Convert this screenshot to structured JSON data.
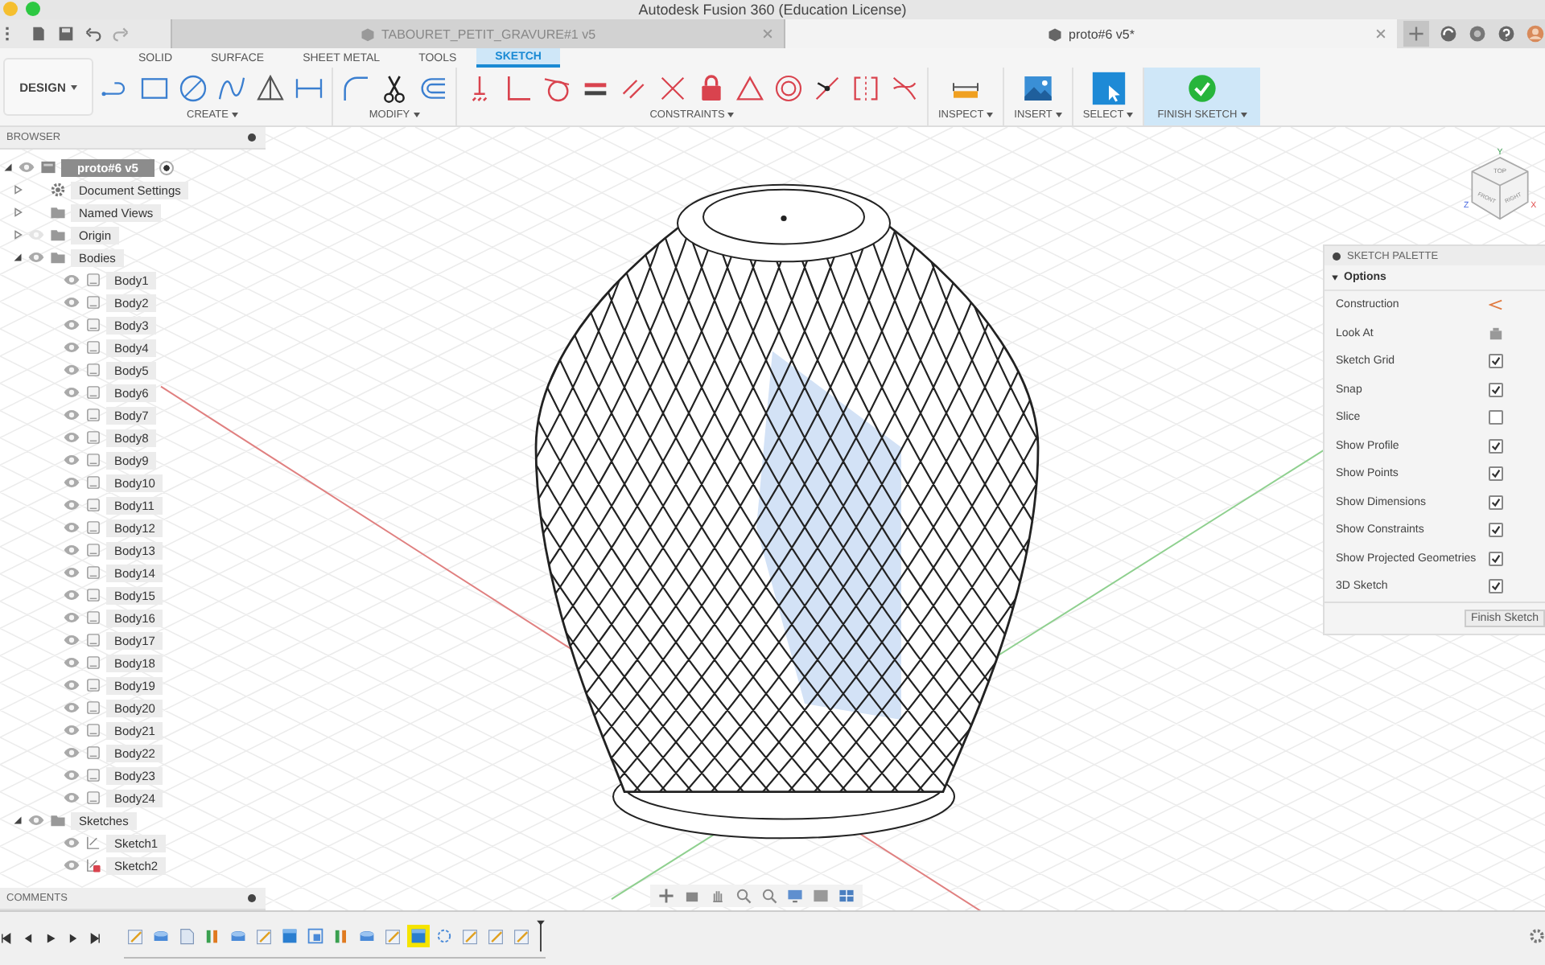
{
  "window": {
    "title": "Autodesk Fusion 360 (Education License)"
  },
  "document_tabs": [
    {
      "label": "TABOURET_PETIT_GRAVURE#1 v5",
      "selected": false
    },
    {
      "label": "proto#6 v5*",
      "selected": true
    }
  ],
  "toolbar": {
    "workspace": "DESIGN",
    "tabs": [
      {
        "label": "SOLID",
        "selected": false
      },
      {
        "label": "SURFACE",
        "selected": false
      },
      {
        "label": "SHEET METAL",
        "selected": false
      },
      {
        "label": "TOOLS",
        "selected": false
      },
      {
        "label": "SKETCH",
        "selected": true
      }
    ],
    "groups": [
      {
        "kind": "create",
        "label": "CREATE"
      },
      {
        "kind": "modify",
        "label": "MODIFY"
      },
      {
        "kind": "constraints",
        "label": "CONSTRAINTS"
      },
      {
        "kind": "inspect",
        "label": "INSPECT"
      },
      {
        "kind": "insert",
        "label": "INSERT"
      },
      {
        "kind": "select",
        "label": "SELECT"
      },
      {
        "kind": "finish",
        "label": "FINISH SKETCH"
      }
    ]
  },
  "browser": {
    "title": "BROWSER",
    "tree": {
      "label": "proto#6 v5",
      "kind": "component",
      "visible": true,
      "active": true,
      "expanded": true,
      "children": [
        {
          "label": "Document Settings",
          "kind": "settings",
          "expanded": false
        },
        {
          "label": "Named Views",
          "kind": "folder",
          "expanded": false
        },
        {
          "label": "Origin",
          "kind": "folder",
          "visible": false,
          "expanded": false
        },
        {
          "label": "Bodies",
          "kind": "folder",
          "visible": true,
          "expanded": true,
          "children": [
            {
              "label": "Body1",
              "kind": "body",
              "visible": true
            },
            {
              "label": "Body2",
              "kind": "body",
              "visible": true
            },
            {
              "label": "Body3",
              "kind": "body",
              "visible": true
            },
            {
              "label": "Body4",
              "kind": "body",
              "visible": true
            },
            {
              "label": "Body5",
              "kind": "body",
              "visible": true
            },
            {
              "label": "Body6",
              "kind": "body",
              "visible": true
            },
            {
              "label": "Body7",
              "kind": "body",
              "visible": true
            },
            {
              "label": "Body8",
              "kind": "body",
              "visible": true
            },
            {
              "label": "Body9",
              "kind": "body",
              "visible": true
            },
            {
              "label": "Body10",
              "kind": "body",
              "visible": true
            },
            {
              "label": "Body11",
              "kind": "body",
              "visible": true
            },
            {
              "label": "Body12",
              "kind": "body",
              "visible": true
            },
            {
              "label": "Body13",
              "kind": "body",
              "visible": true
            },
            {
              "label": "Body14",
              "kind": "body",
              "visible": true
            },
            {
              "label": "Body15",
              "kind": "body",
              "visible": true
            },
            {
              "label": "Body16",
              "kind": "body",
              "visible": true
            },
            {
              "label": "Body17",
              "kind": "body",
              "visible": true
            },
            {
              "label": "Body18",
              "kind": "body",
              "visible": true
            },
            {
              "label": "Body19",
              "kind": "body",
              "visible": true
            },
            {
              "label": "Body20",
              "kind": "body",
              "visible": true
            },
            {
              "label": "Body21",
              "kind": "body",
              "visible": true
            },
            {
              "label": "Body22",
              "kind": "body",
              "visible": true
            },
            {
              "label": "Body23",
              "kind": "body",
              "visible": true
            },
            {
              "label": "Body24",
              "kind": "body",
              "visible": true
            }
          ]
        },
        {
          "label": "Sketches",
          "kind": "folder",
          "visible": true,
          "expanded": true,
          "children": [
            {
              "label": "Sketch1",
              "kind": "sketch",
              "visible": true,
              "error": false
            },
            {
              "label": "Sketch2",
              "kind": "sketch",
              "visible": true,
              "error": true
            }
          ]
        }
      ]
    }
  },
  "view_cube": {
    "faces": [
      "TOP",
      "FRONT",
      "RIGHT"
    ],
    "axes": [
      "Z",
      "X",
      "Y"
    ]
  },
  "sketch_palette": {
    "title": "SKETCH PALETTE",
    "section": "Options",
    "expanded": true,
    "options": [
      {
        "label": "Construction",
        "kind": "action"
      },
      {
        "label": "Look At",
        "kind": "action"
      },
      {
        "label": "Sketch Grid",
        "kind": "checkbox",
        "checked": true
      },
      {
        "label": "Snap",
        "kind": "checkbox",
        "checked": true
      },
      {
        "label": "Slice",
        "kind": "checkbox",
        "checked": false
      },
      {
        "label": "Show Profile",
        "kind": "checkbox",
        "checked": true
      },
      {
        "label": "Show Points",
        "kind": "checkbox",
        "checked": true
      },
      {
        "label": "Show Dimensions",
        "kind": "checkbox",
        "checked": true
      },
      {
        "label": "Show Constraints",
        "kind": "checkbox",
        "checked": true
      },
      {
        "label": "Show Projected Geometries",
        "kind": "checkbox",
        "checked": true
      },
      {
        "label": "3D Sketch",
        "kind": "checkbox",
        "checked": true
      }
    ],
    "button": "Finish Sketch"
  },
  "comments": {
    "title": "COMMENTS"
  },
  "timeline": {
    "features": [
      {
        "kind": "sketch",
        "selected": false
      },
      {
        "kind": "extrude",
        "selected": false
      },
      {
        "kind": "plane",
        "selected": false
      },
      {
        "kind": "pattern",
        "selected": false
      },
      {
        "kind": "extrude",
        "selected": false
      },
      {
        "kind": "sketch",
        "selected": false
      },
      {
        "kind": "box",
        "selected": false
      },
      {
        "kind": "combine",
        "selected": false
      },
      {
        "kind": "pattern",
        "selected": false
      },
      {
        "kind": "extrude",
        "selected": false
      },
      {
        "kind": "sketch",
        "selected": false
      },
      {
        "kind": "box",
        "selected": true
      },
      {
        "kind": "point",
        "selected": false
      },
      {
        "kind": "sketch",
        "selected": false
      },
      {
        "kind": "sketch",
        "selected": false
      },
      {
        "kind": "sketch",
        "selected": false
      }
    ]
  }
}
